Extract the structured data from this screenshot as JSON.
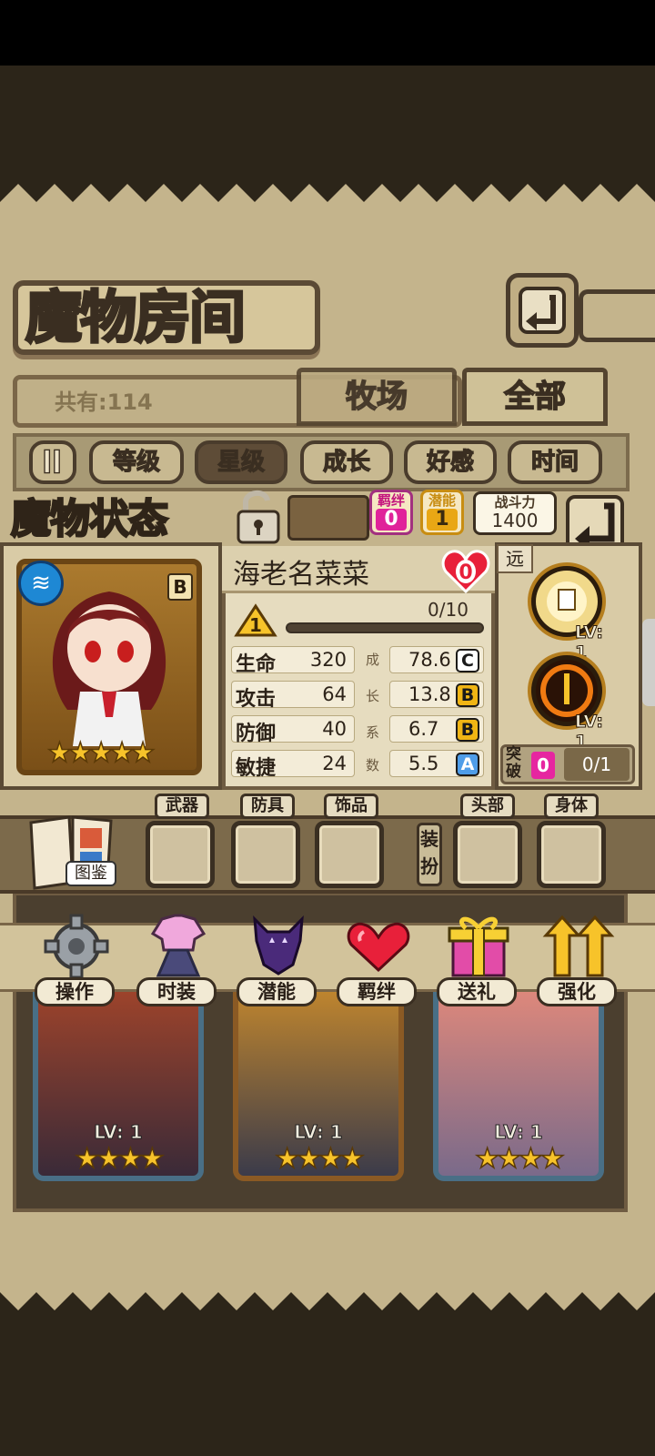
{
  "header": {
    "title": "魔物房间"
  },
  "collection": {
    "count_label": "共有:114",
    "tabs": [
      {
        "label": "牧场"
      },
      {
        "label": "全部"
      }
    ],
    "sort_buttons": [
      {
        "label": "等级"
      },
      {
        "label": "星级"
      },
      {
        "label": "成长"
      },
      {
        "label": "好感"
      },
      {
        "label": "时间"
      }
    ],
    "active_sort": "星级"
  },
  "status_panel": {
    "title": "魔物状态",
    "bond": {
      "label": "羁绊",
      "value": "0"
    },
    "potential": {
      "label": "潜能",
      "value": "1"
    },
    "power": {
      "label": "战斗力",
      "value": "1400"
    }
  },
  "monster": {
    "name": "海老名菜菜",
    "rank": "B",
    "star_count": 5,
    "stars": "★★★★★",
    "affection": "0",
    "level": "1",
    "exp": "0/10",
    "exp_fraction": 0.0,
    "range": "远",
    "growth_label": [
      "成",
      "长",
      "系",
      "数"
    ],
    "stats": [
      {
        "name": "生命",
        "value": "320",
        "growth": "78.6",
        "grade": "C"
      },
      {
        "name": "攻击",
        "value": "64",
        "growth": "13.8",
        "grade": "B"
      },
      {
        "name": "防御",
        "value": "40",
        "growth": "6.7",
        "grade": "B"
      },
      {
        "name": "敏捷",
        "value": "24",
        "growth": "5.5",
        "grade": "A"
      }
    ],
    "skills": [
      {
        "level": "LV: 1"
      },
      {
        "level": "LV: 1"
      }
    ],
    "breakthrough": {
      "label": "突破",
      "count": "0",
      "progress": "0/1"
    }
  },
  "equipment": {
    "codex_label": "图鉴",
    "slots": [
      {
        "label": "武器"
      },
      {
        "label": "防具"
      },
      {
        "label": "饰品"
      }
    ],
    "dress_label": "装扮",
    "dress_slots": [
      {
        "label": "头部"
      },
      {
        "label": "身体"
      }
    ]
  },
  "actions": [
    {
      "label": "操作",
      "icon": "gear-icon"
    },
    {
      "label": "时装",
      "icon": "outfit-icon"
    },
    {
      "label": "潜能",
      "icon": "demon-icon"
    },
    {
      "label": "羁绊",
      "icon": "hearts-icon"
    },
    {
      "label": "送礼",
      "icon": "gift-icon"
    },
    {
      "label": "强化",
      "icon": "upgrade-arrows-icon"
    }
  ],
  "monster_list": [
    {
      "level": "LV: 1",
      "stars": "★★★★"
    },
    {
      "level": "LV: 1",
      "stars": "★★★★"
    },
    {
      "level": "LV: 1",
      "stars": "★★★★"
    }
  ]
}
